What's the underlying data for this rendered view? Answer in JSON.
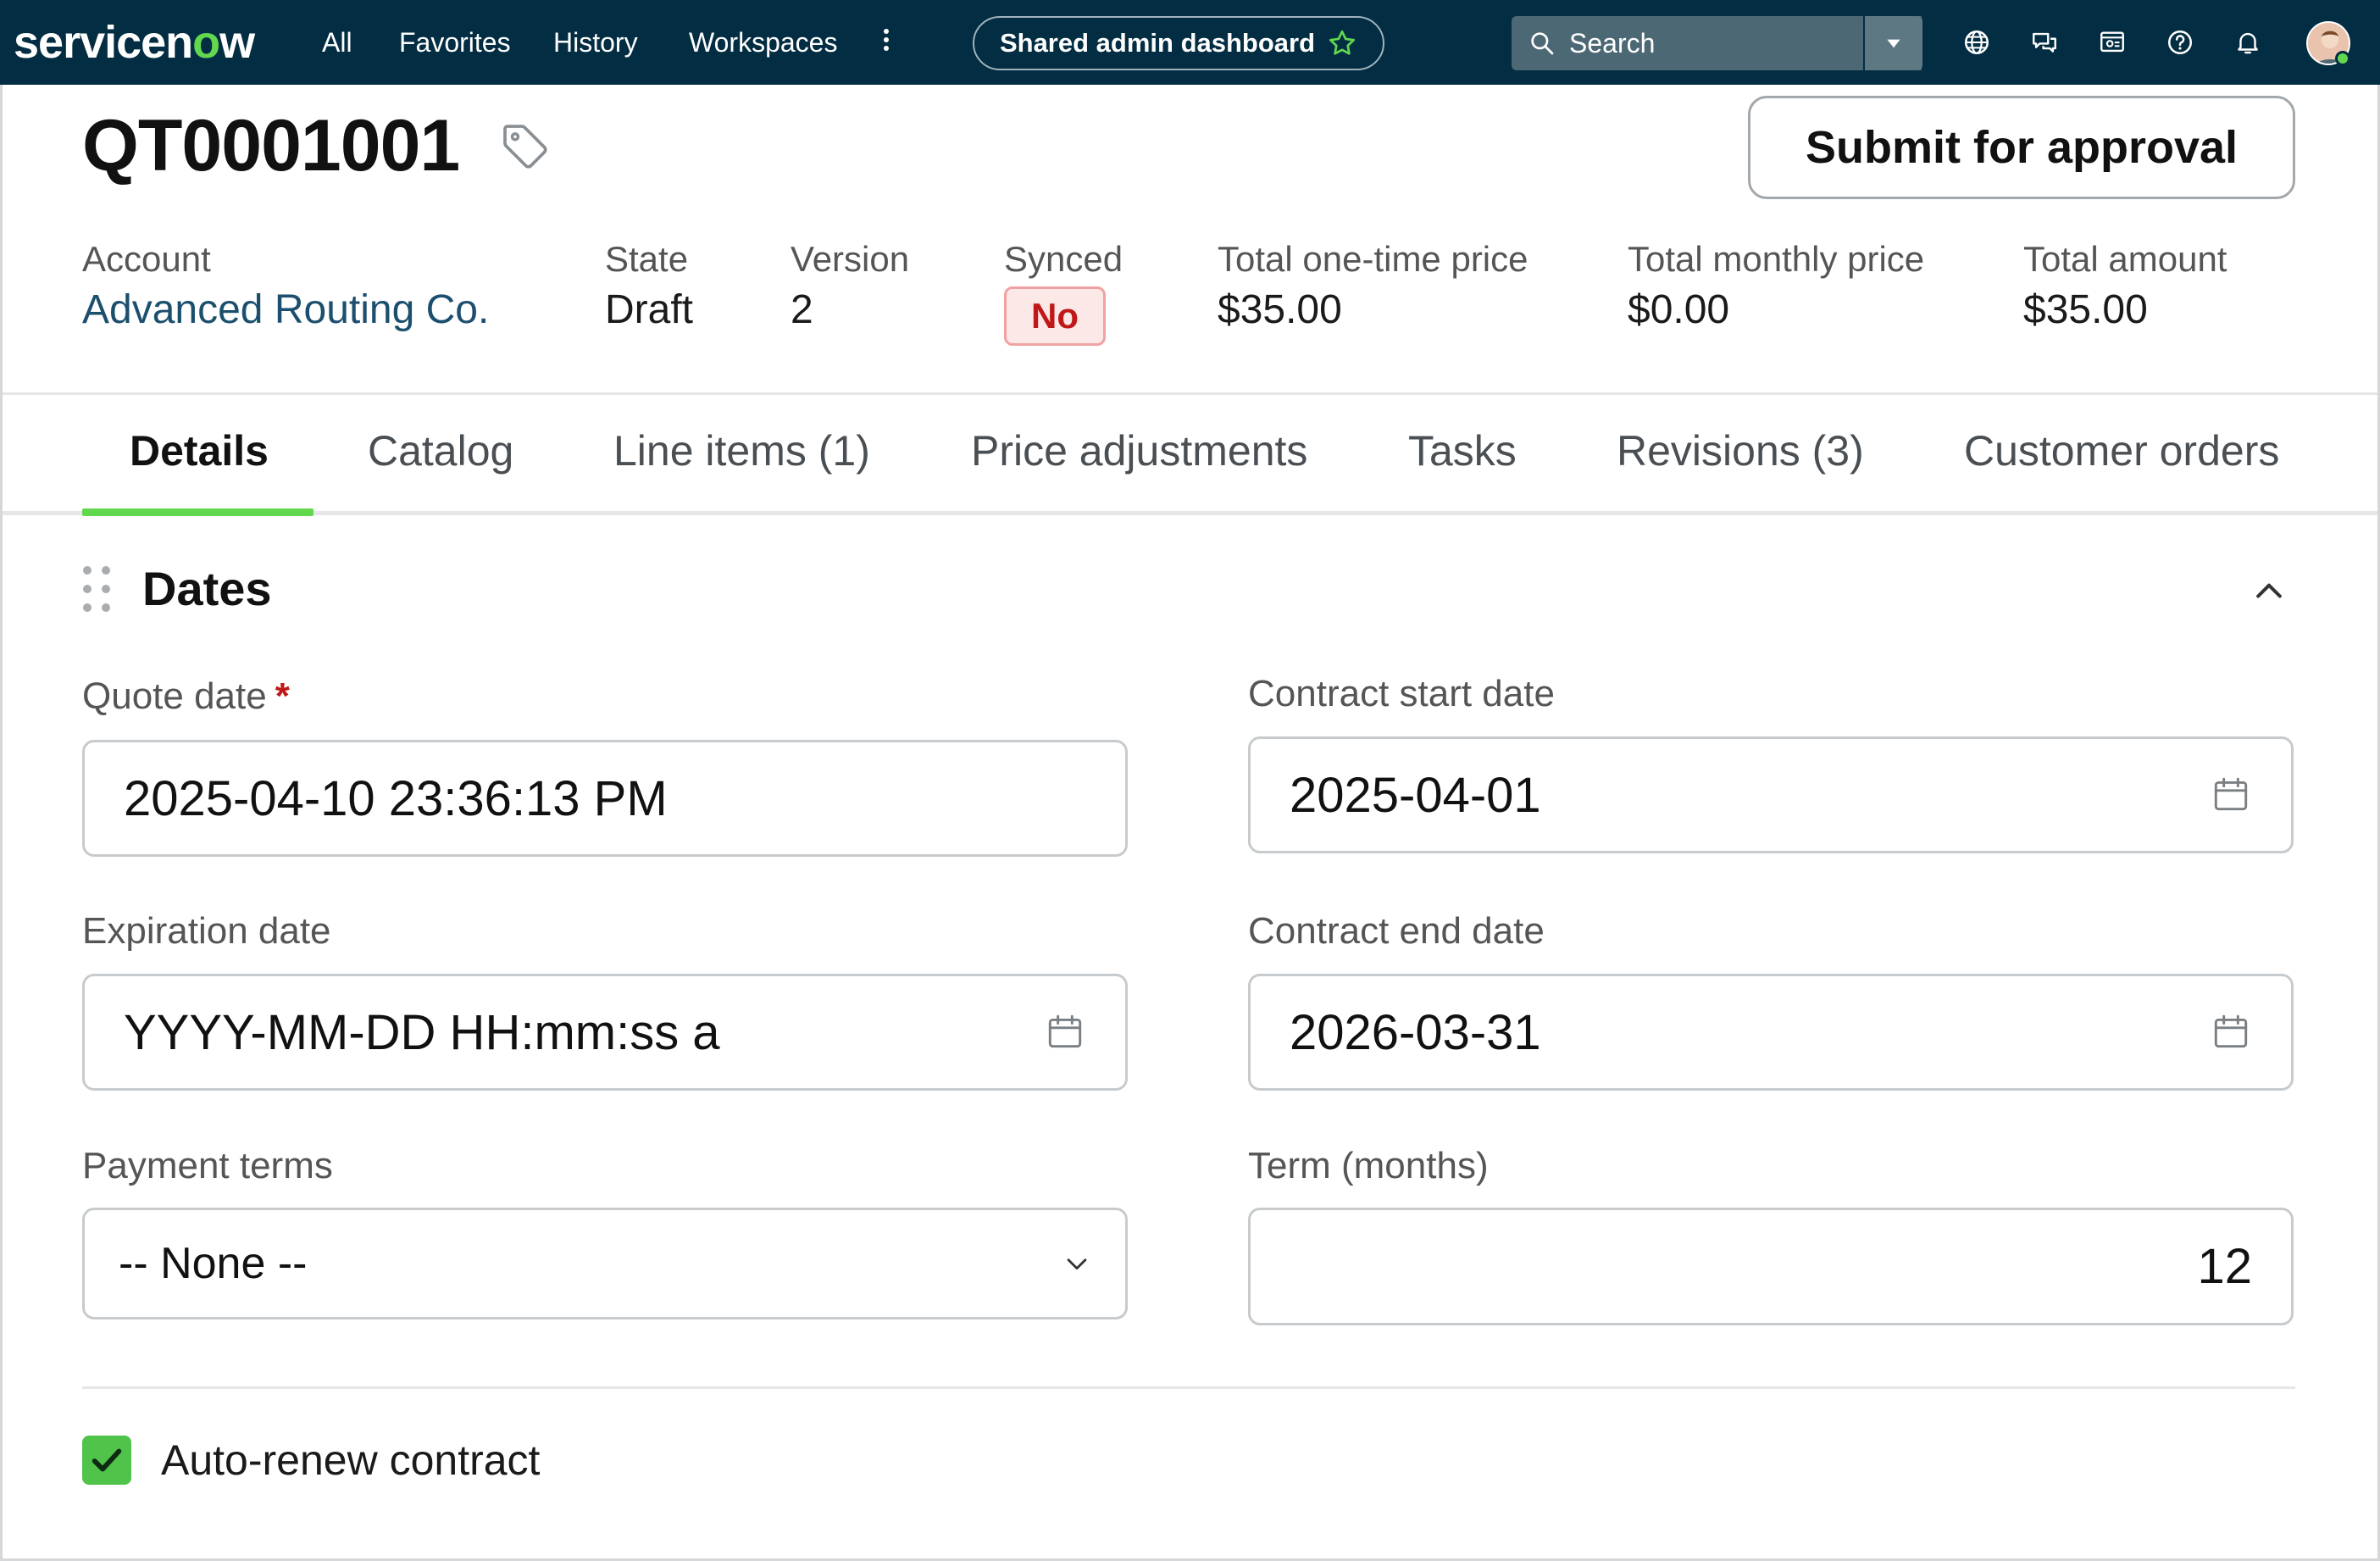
{
  "nav": {
    "brand_prefix": "servicen",
    "brand_o": "o",
    "brand_suffix": "w",
    "links": [
      "All",
      "Favorites",
      "History",
      "Workspaces"
    ],
    "workspace_pill": "Shared admin dashboard",
    "search_placeholder": "Search",
    "icons": [
      "globe-icon",
      "chat-icon",
      "inbox-icon",
      "help-icon",
      "bell-icon",
      "avatar"
    ]
  },
  "record": {
    "number": "QT0001001",
    "submit_label": "Submit for approval"
  },
  "meta": {
    "account_label": "Account",
    "account_value": "Advanced Routing Co.",
    "state_label": "State",
    "state_value": "Draft",
    "version_label": "Version",
    "version_value": "2",
    "synced_label": "Synced",
    "synced_value": "No",
    "one_time_label": "Total one-time price",
    "one_time_value": "$35.00",
    "monthly_label": "Total monthly price",
    "monthly_value": "$0.00",
    "total_label": "Total amount",
    "total_value": "$35.00"
  },
  "tabs": [
    "Details",
    "Catalog",
    "Line items (1)",
    "Price adjustments",
    "Tasks",
    "Revisions (3)",
    "Customer orders"
  ],
  "active_tab": "Details",
  "section": {
    "title": "Dates",
    "fields": {
      "quote_date_label": "Quote date",
      "quote_date_required": "*",
      "quote_date_value": "2025-04-10 23:36:13 PM",
      "contract_start_label": "Contract start date",
      "contract_start_value": "2025-04-01",
      "expiration_label": "Expiration date",
      "expiration_placeholder": "YYYY-MM-DD HH:mm:ss a",
      "contract_end_label": "Contract end date",
      "contract_end_value": "2026-03-31",
      "payment_terms_label": "Payment terms",
      "payment_terms_value": "-- None --",
      "term_label": "Term (months)",
      "term_value": "12"
    },
    "auto_renew_label": "Auto-renew contract",
    "auto_renew_checked": true
  },
  "colors": {
    "nav_bg": "#032d42",
    "accent_green": "#62d84e",
    "badge_red": "#c01818",
    "link_blue": "#1c4f6e"
  }
}
